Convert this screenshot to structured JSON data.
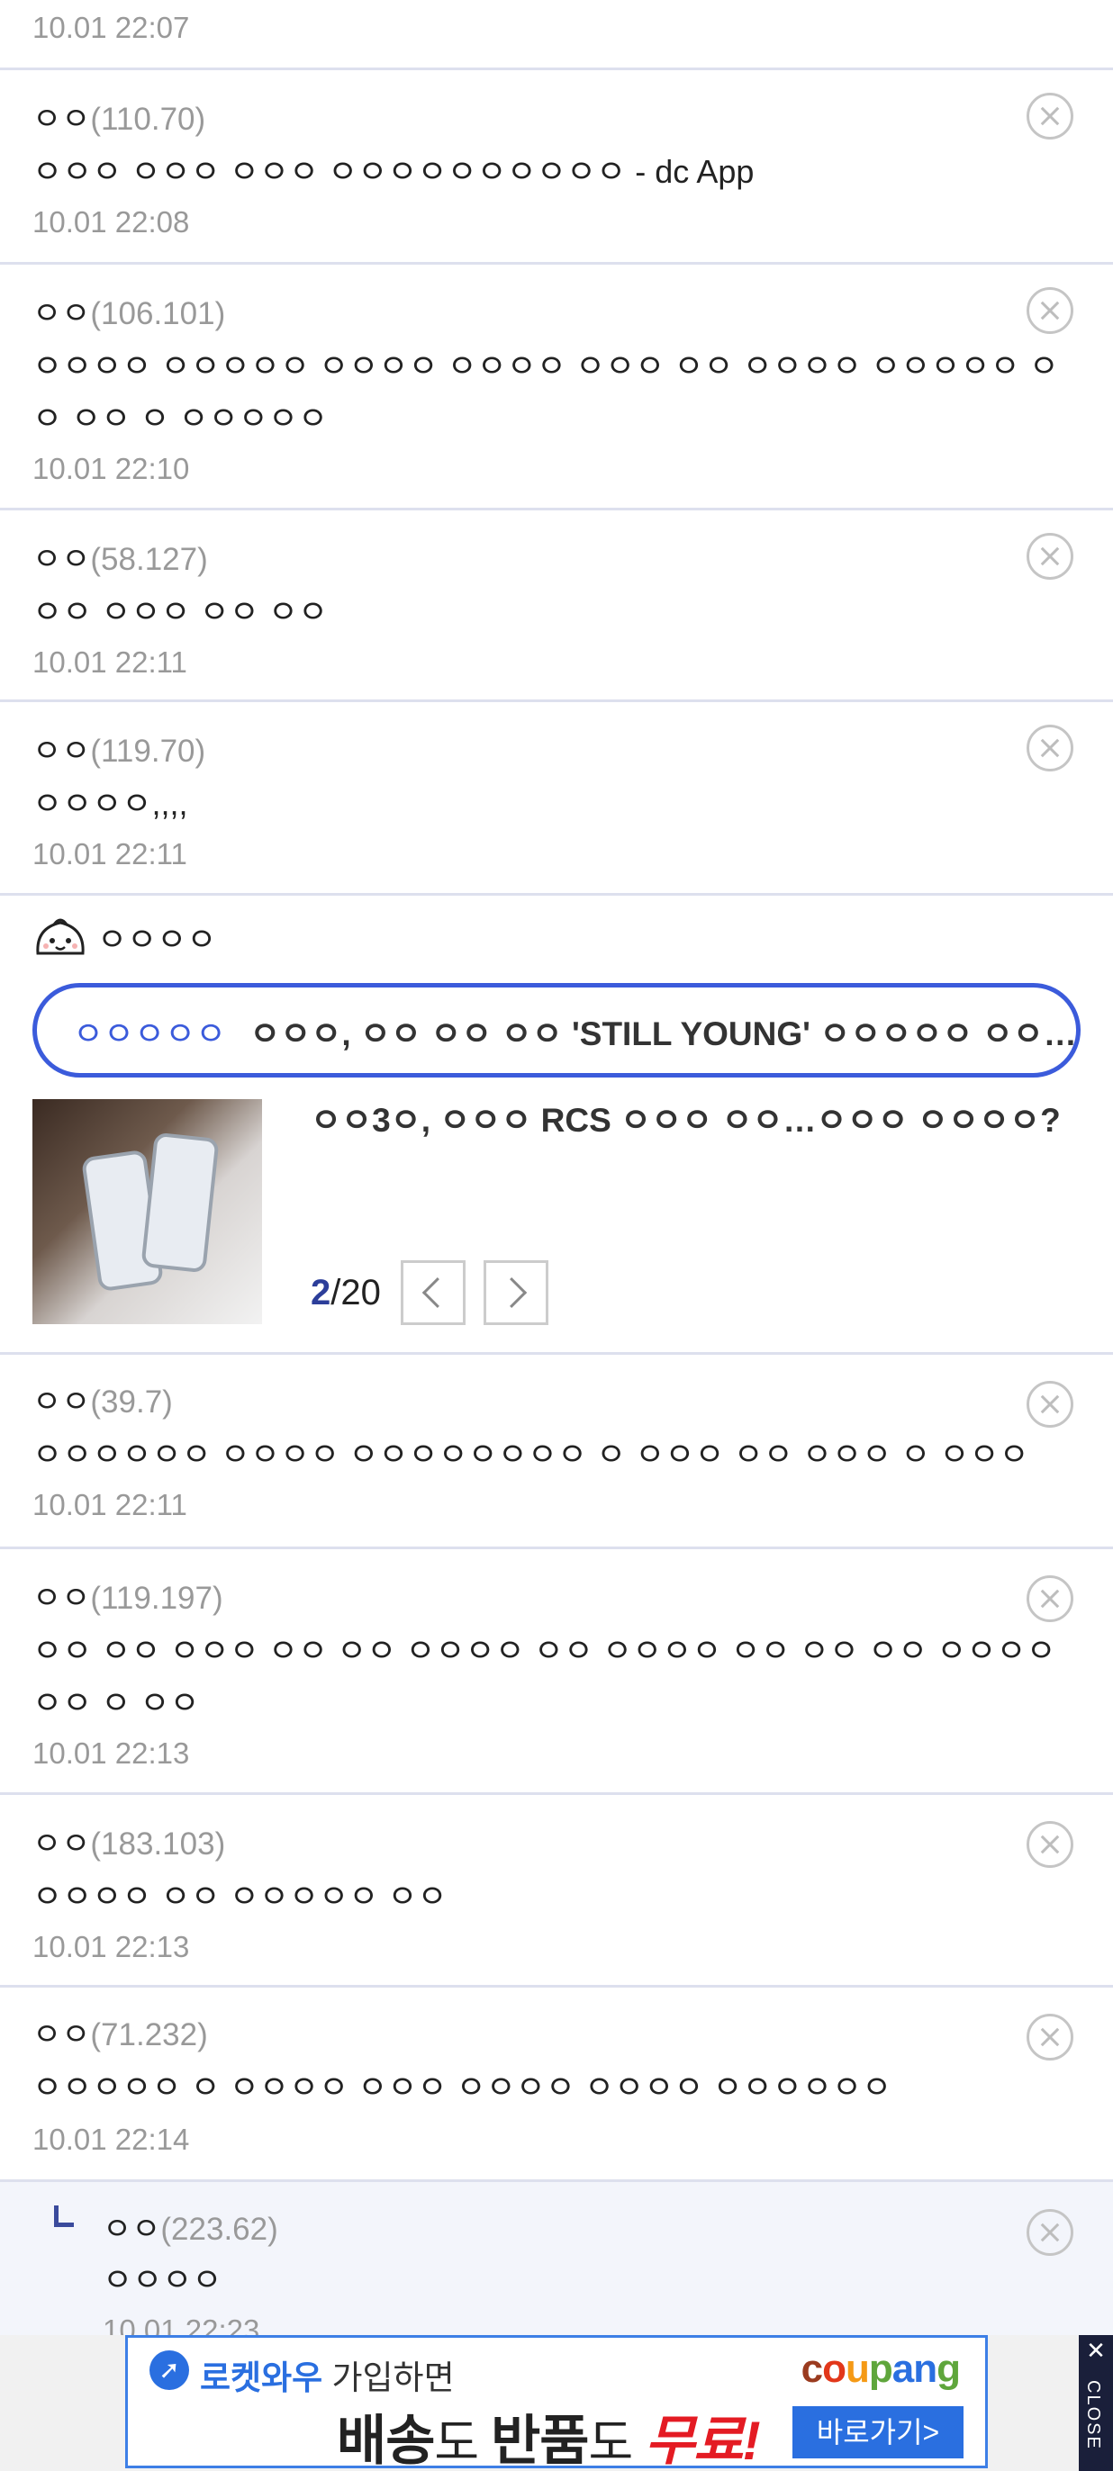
{
  "top": {
    "date": "10.01 22:07"
  },
  "comments_a": [
    {
      "author": "ㅇㅇ",
      "ip": "(110.70)",
      "text": "ㅇㅇㅇ ㅇㅇㅇ ㅇㅇㅇ ㅇㅇㅇㅇㅇㅇㅇㅇㅇㅇ - dc App",
      "date": "10.01 22:08"
    },
    {
      "author": "ㅇㅇ",
      "ip": "(106.101)",
      "text": "ㅇㅇㅇㅇ ㅇㅇㅇㅇㅇ ㅇㅇㅇㅇ ㅇㅇㅇㅇ ㅇㅇㅇ ㅇㅇ ㅇㅇㅇㅇ ㅇㅇㅇㅇㅇ ㅇㅇ ㅇㅇ ㅇ ㅇㅇㅇㅇㅇ",
      "date": "10.01 22:10"
    },
    {
      "author": "ㅇㅇ",
      "ip": "(58.127)",
      "text": "ㅇㅇ ㅇㅇㅇ ㅇㅇ ㅇㅇ",
      "date": "10.01 22:11"
    },
    {
      "author": "ㅇㅇ",
      "ip": "(119.70)",
      "text": "ㅇㅇㅇㅇ,,,,",
      "date": "10.01 22:11"
    }
  ],
  "news": {
    "section_name": "ㅇㅇㅇㅇ",
    "tag": "ㅇㅇㅇㅇㅇ",
    "headline": "ㅇㅇㅇ, ㅇㅇ ㅇㅇ ㅇㅇ 'STILL YOUNG' ㅇㅇㅇㅇㅇ ㅇㅇ……",
    "article_title": "ㅇㅇ3ㅇ, ㅇㅇㅇ RCS ㅇㅇㅇ ㅇㅇ…ㅇㅇㅇ ㅇㅇㅇㅇ?",
    "page_current": "2",
    "page_total": "/20"
  },
  "comments_b": [
    {
      "author": "ㅇㅇ",
      "ip": "(39.7)",
      "text": "ㅇㅇㅇㅇㅇㅇ ㅇㅇㅇㅇ ㅇㅇㅇㅇㅇㅇㅇㅇ ㅇ ㅇㅇㅇ ㅇㅇ ㅇㅇㅇ ㅇ ㅇㅇㅇ",
      "date": "10.01 22:11"
    },
    {
      "author": "ㅇㅇ",
      "ip": "(119.197)",
      "text": "ㅇㅇ ㅇㅇ ㅇㅇㅇ ㅇㅇ ㅇㅇ ㅇㅇㅇㅇ ㅇㅇ ㅇㅇㅇㅇ ㅇㅇ ㅇㅇ ㅇㅇ ㅇㅇㅇㅇ ㅇㅇ ㅇ ㅇㅇ",
      "date": "10.01 22:13"
    },
    {
      "author": "ㅇㅇ",
      "ip": "(183.103)",
      "text": "ㅇㅇㅇㅇ ㅇㅇ ㅇㅇㅇㅇㅇ ㅇㅇ",
      "date": "10.01 22:13"
    },
    {
      "author": "ㅇㅇ",
      "ip": "(71.232)",
      "text": "ㅇㅇㅇㅇㅇ ㅇ ㅇㅇㅇㅇ ㅇㅇㅇ ㅇㅇㅇㅇ ㅇㅇㅇㅇ ㅇㅇㅇㅇㅇㅇ",
      "date": "10.01 22:14"
    }
  ],
  "reply": {
    "author": "ㅇㅇ",
    "ip": "(223.62)",
    "text": "ㅇㅇㅇㅇ",
    "date": "10.01 22:23"
  },
  "ad": {
    "line1_bold": "로켓와우",
    "line1_rest": " 가입하면",
    "line2_a": "배송",
    "line2_b": "도 ",
    "line2_c": "반품",
    "line2_d": "도 ",
    "line2_e": "무료!",
    "brand": "coupang",
    "go_label": "바로가기>",
    "close_x": "✕",
    "close_label": "CLOSE",
    "brand_colors": [
      "#9a3b1f",
      "#e2371a",
      "#f59a16",
      "#5fa63c",
      "#2a6fe0",
      "#2a6fe0",
      "#5fa63c"
    ]
  }
}
